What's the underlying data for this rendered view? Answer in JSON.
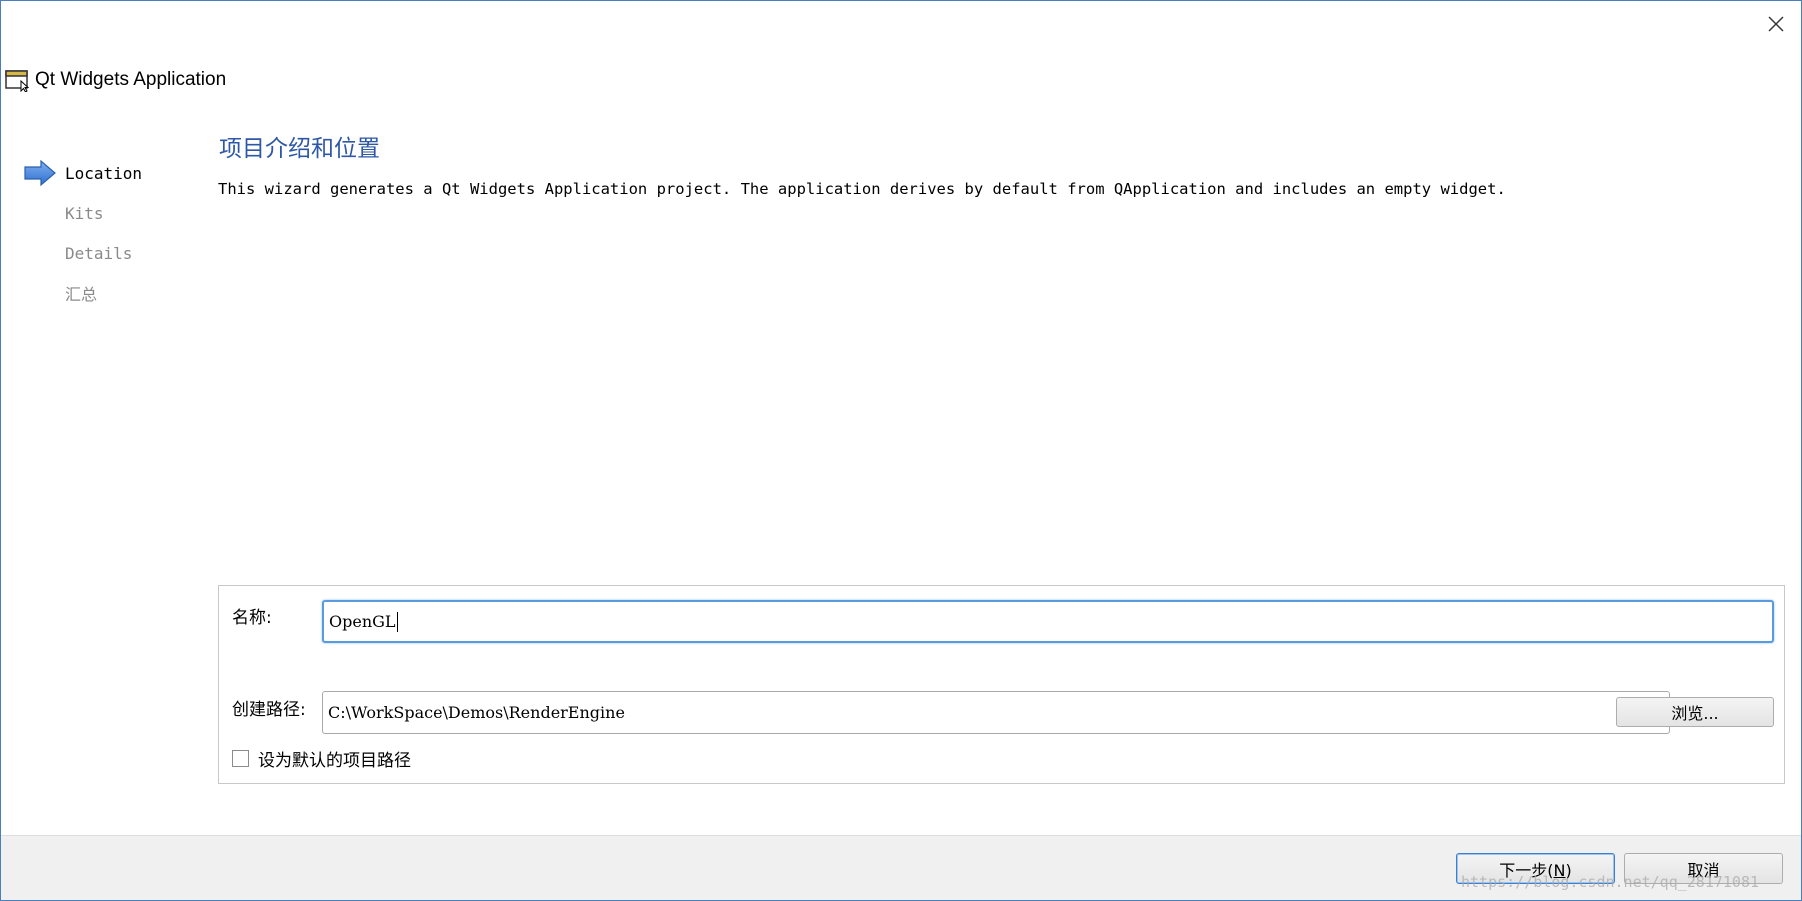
{
  "window": {
    "title": "Qt Widgets Application",
    "close_icon": "close-icon",
    "app_icon": "window-app-icon"
  },
  "steps": [
    {
      "label": "Location",
      "active": true
    },
    {
      "label": "Kits",
      "active": false
    },
    {
      "label": "Details",
      "active": false
    },
    {
      "label": "汇总",
      "active": false
    }
  ],
  "page": {
    "title": "项目介绍和位置",
    "description": "This wizard generates a Qt Widgets Application project. The application derives by default from QApplication and includes an empty widget."
  },
  "form": {
    "name_label": "名称:",
    "name_value": "OpenGL",
    "path_label": "创建路径:",
    "path_value": "C:\\WorkSpace\\Demos\\RenderEngine",
    "browse_label": "浏览...",
    "default_path_label": "设为默认的项目路径",
    "default_path_checked": false
  },
  "footer": {
    "next_label_prefix": "下一步(",
    "next_mnemonic": "N",
    "next_label_suffix": ")",
    "cancel_label": "取消"
  },
  "watermark": "https://blog.csdn.net/qq_28171081",
  "colors": {
    "accent": "#2e58a6",
    "step_arrow": "#3b7ddd",
    "focus_border": "#5a9bdc",
    "footer_bg": "#f0f0f0"
  }
}
